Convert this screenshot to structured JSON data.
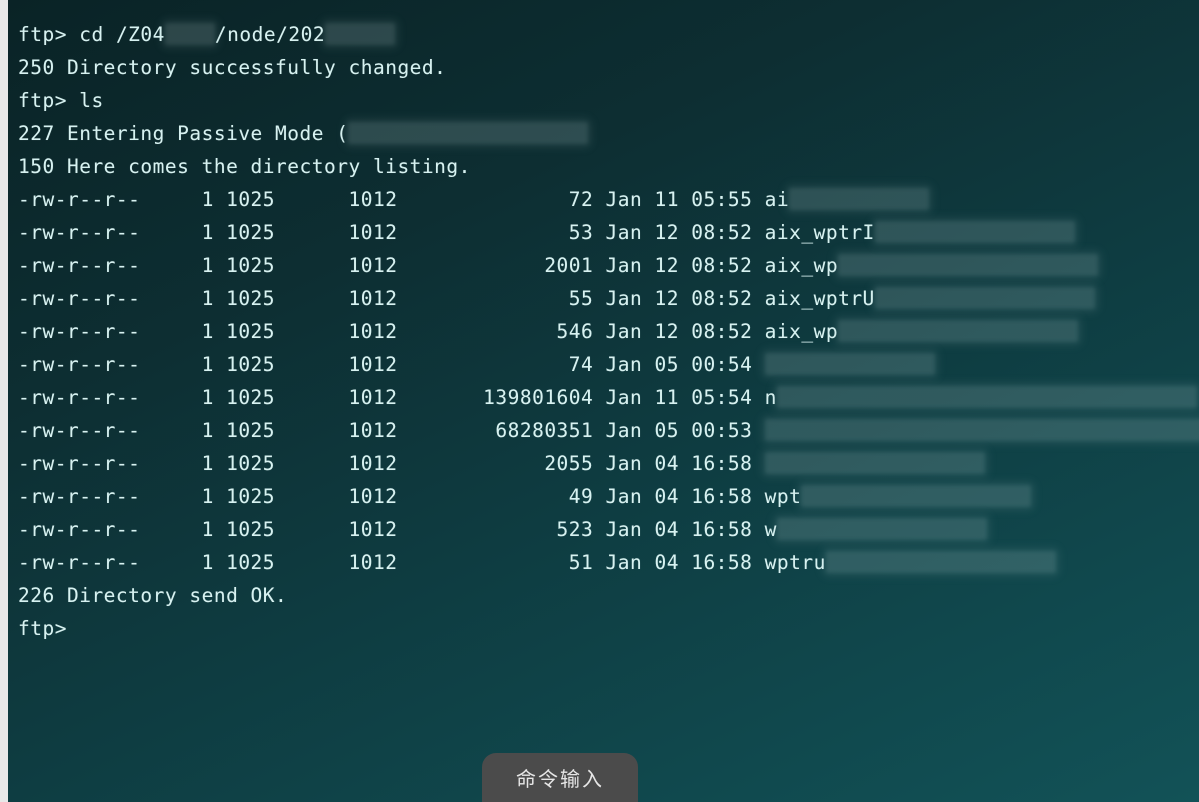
{
  "prompt": "ftp>",
  "cmd_cd": "cd /Z04",
  "cd_tail": "/node/202",
  "resp_250": "250 Directory successfully changed.",
  "cmd_ls": "ls",
  "resp_227": "227 Entering Passive Mode (",
  "resp_150": "150 Here comes the directory listing.",
  "perm": "-rw-r--r--",
  "links": "1",
  "owner": "1025",
  "group": "1012",
  "rows": [
    {
      "size": "72",
      "date": "Jan 11 05:55",
      "name": "ai",
      "blurw": 140
    },
    {
      "size": "53",
      "date": "Jan 12 08:52",
      "name": "aix_wptrI",
      "blurw": 200
    },
    {
      "size": "2001",
      "date": "Jan 12 08:52",
      "name": "aix_wp",
      "blurw": 260
    },
    {
      "size": "55",
      "date": "Jan 12 08:52",
      "name": "aix_wptrU",
      "blurw": 220
    },
    {
      "size": "546",
      "date": "Jan 12 08:52",
      "name": "aix_wp",
      "blurw": 240
    },
    {
      "size": "74",
      "date": "Jan 05 00:54",
      "name": "",
      "blurw": 170
    },
    {
      "size": "139801604",
      "date": "Jan 11 05:54",
      "name": "n",
      "blurw": 420
    },
    {
      "size": "68280351",
      "date": "Jan 05 00:53",
      "name": "",
      "blurw": 480
    },
    {
      "size": "2055",
      "date": "Jan 04 16:58",
      "name": "",
      "blurw": 220
    },
    {
      "size": "49",
      "date": "Jan 04 16:58",
      "name": "wpt",
      "blurw": 230
    },
    {
      "size": "523",
      "date": "Jan 04 16:58",
      "name": "w",
      "blurw": 210
    },
    {
      "size": "51",
      "date": "Jan 04 16:58",
      "name": "wptru",
      "blurw": 230
    }
  ],
  "resp_226": "226 Directory send OK.",
  "pill_label": "命令输入"
}
